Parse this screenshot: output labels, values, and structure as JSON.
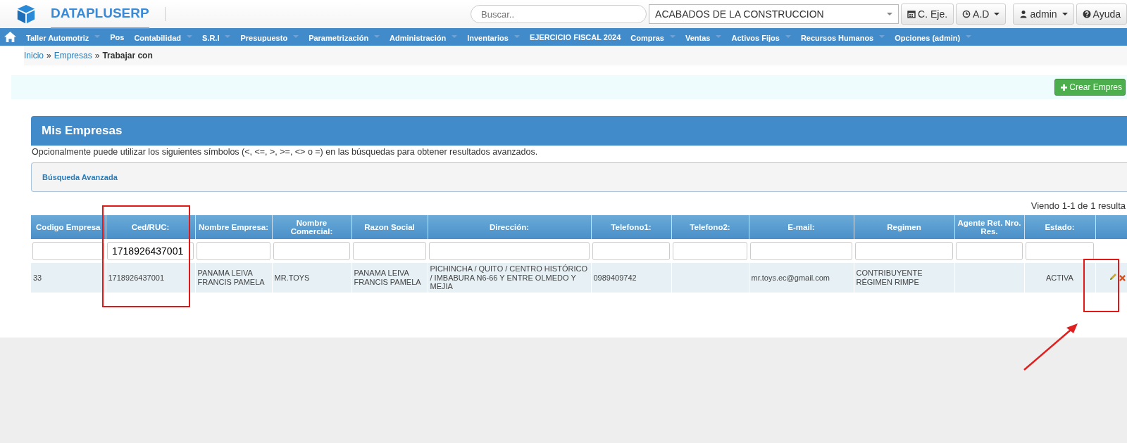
{
  "header": {
    "logo_text": "DATAPLUSERP",
    "search": {
      "placeholder": "Buscar.."
    },
    "company_select": "ACABADOS DE LA CONSTRUCCION",
    "buttons": [
      {
        "label": "C. Eje.",
        "has_caret": false
      },
      {
        "label": "A.D",
        "has_caret": true
      },
      {
        "label": "admin",
        "has_caret": true
      },
      {
        "label": "Ayuda",
        "has_caret": false
      }
    ]
  },
  "nav": [
    {
      "label": "Taller Automotriz",
      "has_caret": true
    },
    {
      "label": "Pos",
      "has_caret": false
    },
    {
      "label": "Contabilidad",
      "has_caret": true
    },
    {
      "label": "S.R.I",
      "has_caret": true
    },
    {
      "label": "Presupuesto",
      "has_caret": true
    },
    {
      "label": "Parametrización",
      "has_caret": true
    },
    {
      "label": "Administración",
      "has_caret": true
    },
    {
      "label": "Inventarios",
      "has_caret": true
    },
    {
      "label": "EJERCICIO FISCAL 2024",
      "has_caret": false
    },
    {
      "label": "Compras",
      "has_caret": true
    },
    {
      "label": "Ventas",
      "has_caret": true
    },
    {
      "label": "Activos Fijos",
      "has_caret": true
    },
    {
      "label": "Recursos Humanos",
      "has_caret": true
    },
    {
      "label": "Opciones (admin)",
      "has_caret": true
    }
  ],
  "breadcrumb": [
    {
      "label": "Inicio",
      "link": true
    },
    {
      "separator_before": "»",
      "label": "Empresas",
      "link": true
    },
    {
      "separator_before": "»",
      "label": "Trabajar con",
      "link": false
    }
  ],
  "create_button": "Crear Empres",
  "panel": {
    "title": "Mis Empresas",
    "note": "Opcionalmente puede utilizar los siguientes símbolos (<, <=, >, >=, <> o =) en las búsquedas para obtener resultados avanzados.",
    "advanced_search": "Búsqueda Avanzada"
  },
  "results_summary": "Viendo 1-1 de 1 resulta",
  "table": {
    "columns": [
      {
        "label": "Codigo Empresa"
      },
      {
        "label": "Ced/RUC:",
        "filter": "1718926437001"
      },
      {
        "label": "Nombre Empresa:"
      },
      {
        "label": "Nombre Comercial:"
      },
      {
        "label": "Razon Social"
      },
      {
        "label": "Dirección:"
      },
      {
        "label": "Telefono1:"
      },
      {
        "label": "Telefono2:"
      },
      {
        "label": "E-mail:"
      },
      {
        "label": "Regimen"
      },
      {
        "label": "Agente Ret. Nro. Res."
      },
      {
        "label": "Estado:"
      }
    ],
    "rows": [
      {
        "cells": [
          "33",
          "1718926437001",
          "PANAMA LEIVA FRANCIS PAMELA",
          "MR.TOYS",
          "PANAMA LEIVA FRANCIS PAMELA",
          "PICHINCHA / QUITO / CENTRO HISTÓRICO / IMBABURA N6-66 Y ENTRE OLMEDO Y MEJIA",
          "0989409742",
          null,
          "mr.toys.ec@gmail.com",
          "CONTRIBUYENTE RÉGIMEN RIMPE",
          null,
          "ACTIVA"
        ]
      }
    ]
  }
}
